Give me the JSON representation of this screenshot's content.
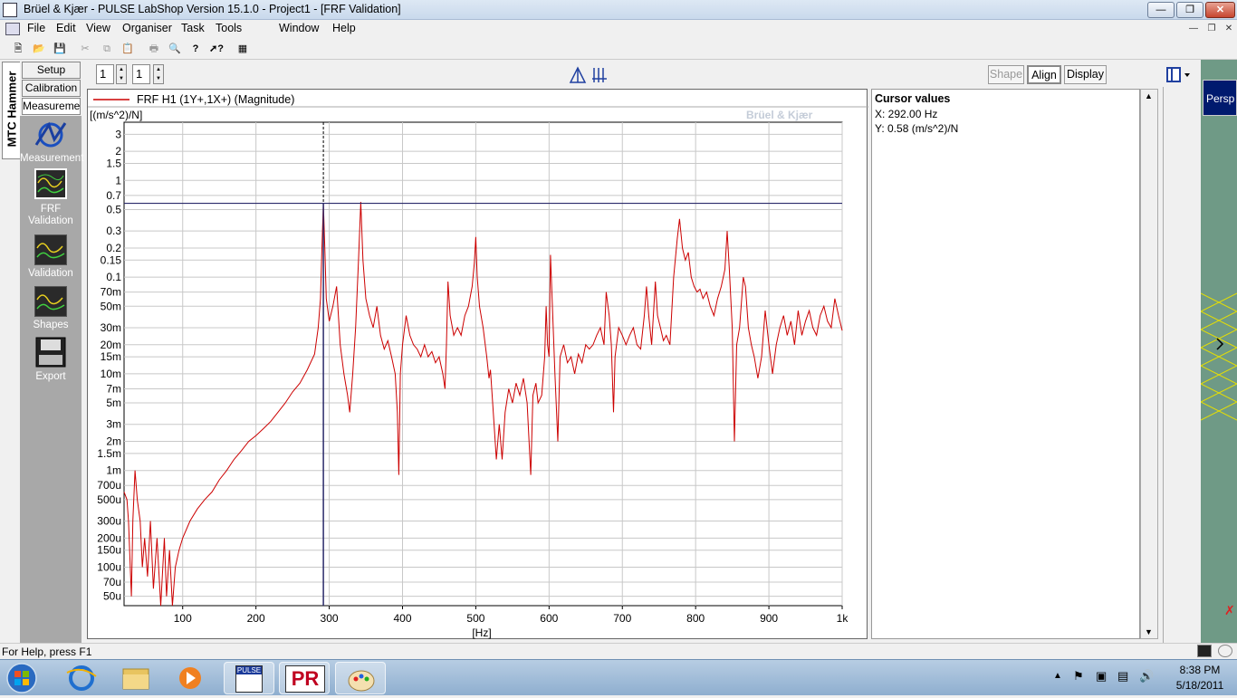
{
  "window": {
    "title": "Brüel & Kjær - PULSE LabShop Version 15.1.0 - Project1 - [FRF Validation]"
  },
  "menu": {
    "items": [
      "File",
      "Edit",
      "View",
      "Organiser",
      "Task",
      "Tools",
      "Window",
      "Help"
    ]
  },
  "spinners": {
    "first": "1",
    "second": "1"
  },
  "view_buttons": {
    "shape": "Shape",
    "align": "Align",
    "display": "Display"
  },
  "side_tabs": {
    "vertical": "MTC Hammer",
    "setup": "Setup",
    "calibration": "Calibration",
    "measurement": "Measurement"
  },
  "task_icons": [
    {
      "label": "Measurement"
    },
    {
      "label": "FRF Validation"
    },
    {
      "label": "Validation"
    },
    {
      "label": "Shapes"
    },
    {
      "label": "Export"
    }
  ],
  "graph": {
    "legend": "FRF H1 (1Y+,1X+) (Magnitude)",
    "yunit": "[(m/s^2)/N]",
    "xunit": "[Hz]",
    "watermark": "Brüel & Kjær",
    "trace_color": "#cc0000",
    "cursor_color": "#2a2a6a"
  },
  "cursor": {
    "title": "Cursor values",
    "x": "X: 292.00 Hz",
    "y": "Y: 0.58 (m/s^2)/N"
  },
  "right_tab": "Persp",
  "status": {
    "text": "For Help, press F1"
  },
  "taskbar": {
    "time": "8:38 PM",
    "date": "5/18/2011",
    "pulse_label": "PULSE",
    "pr_label": "PR"
  },
  "chart_data": {
    "type": "line",
    "xlabel": "[Hz]",
    "ylabel": "[(m/s^2)/N]",
    "xscale": "linear",
    "yscale": "log",
    "xlim": [
      20,
      1000
    ],
    "ylim": [
      4e-05,
      4
    ],
    "xticks": [
      {
        "v": 100,
        "t": "100"
      },
      {
        "v": 200,
        "t": "200"
      },
      {
        "v": 300,
        "t": "300"
      },
      {
        "v": 400,
        "t": "400"
      },
      {
        "v": 500,
        "t": "500"
      },
      {
        "v": 600,
        "t": "600"
      },
      {
        "v": 700,
        "t": "700"
      },
      {
        "v": 800,
        "t": "800"
      },
      {
        "v": 900,
        "t": "900"
      },
      {
        "v": 1000,
        "t": "1k"
      }
    ],
    "yticks": [
      {
        "v": 3,
        "t": "3"
      },
      {
        "v": 2,
        "t": "2"
      },
      {
        "v": 1.5,
        "t": "1.5"
      },
      {
        "v": 1,
        "t": "1"
      },
      {
        "v": 0.7,
        "t": "0.7"
      },
      {
        "v": 0.5,
        "t": "0.5"
      },
      {
        "v": 0.3,
        "t": "0.3"
      },
      {
        "v": 0.2,
        "t": "0.2"
      },
      {
        "v": 0.15,
        "t": "0.15"
      },
      {
        "v": 0.1,
        "t": "0.1"
      },
      {
        "v": 0.07,
        "t": "70m"
      },
      {
        "v": 0.05,
        "t": "50m"
      },
      {
        "v": 0.03,
        "t": "30m"
      },
      {
        "v": 0.02,
        "t": "20m"
      },
      {
        "v": 0.015,
        "t": "15m"
      },
      {
        "v": 0.01,
        "t": "10m"
      },
      {
        "v": 0.007,
        "t": "7m"
      },
      {
        "v": 0.005,
        "t": "5m"
      },
      {
        "v": 0.003,
        "t": "3m"
      },
      {
        "v": 0.002,
        "t": "2m"
      },
      {
        "v": 0.0015,
        "t": "1.5m"
      },
      {
        "v": 0.001,
        "t": "1m"
      },
      {
        "v": 0.0007,
        "t": "700u"
      },
      {
        "v": 0.0005,
        "t": "500u"
      },
      {
        "v": 0.0003,
        "t": "300u"
      },
      {
        "v": 0.0002,
        "t": "200u"
      },
      {
        "v": 0.00015,
        "t": "150u"
      },
      {
        "v": 0.0001,
        "t": "100u"
      },
      {
        "v": 7e-05,
        "t": "70u"
      },
      {
        "v": 5e-05,
        "t": "50u"
      }
    ],
    "cursor": {
      "x": 292,
      "y": 0.58
    },
    "series": [
      {
        "name": "FRF H1 (1Y+,1X+) (Magnitude)",
        "points": [
          [
            20,
            0.0006
          ],
          [
            24,
            0.0005
          ],
          [
            26,
            0.0003
          ],
          [
            30,
            5e-05
          ],
          [
            32,
            0.0003
          ],
          [
            35,
            0.001
          ],
          [
            38,
            0.0005
          ],
          [
            42,
            0.0003
          ],
          [
            45,
            0.0001
          ],
          [
            48,
            0.0002
          ],
          [
            52,
            8e-05
          ],
          [
            56,
            0.0003
          ],
          [
            60,
            6e-05
          ],
          [
            65,
            0.0002
          ],
          [
            70,
            4e-05
          ],
          [
            75,
            0.0002
          ],
          [
            78,
            5e-05
          ],
          [
            82,
            0.00015
          ],
          [
            86,
            4e-05
          ],
          [
            90,
            0.0001
          ],
          [
            95,
            0.00015
          ],
          [
            100,
            0.0002
          ],
          [
            110,
            0.0003
          ],
          [
            120,
            0.0004
          ],
          [
            130,
            0.0005
          ],
          [
            140,
            0.0006
          ],
          [
            150,
            0.0008
          ],
          [
            160,
            0.001
          ],
          [
            170,
            0.0013
          ],
          [
            180,
            0.0016
          ],
          [
            190,
            0.002
          ],
          [
            200,
            0.0023
          ],
          [
            210,
            0.0027
          ],
          [
            220,
            0.0032
          ],
          [
            230,
            0.004
          ],
          [
            240,
            0.005
          ],
          [
            250,
            0.0065
          ],
          [
            260,
            0.008
          ],
          [
            270,
            0.011
          ],
          [
            280,
            0.016
          ],
          [
            285,
            0.03
          ],
          [
            288,
            0.06
          ],
          [
            290,
            0.2
          ],
          [
            292,
            0.58
          ],
          [
            294,
            0.2
          ],
          [
            296,
            0.06
          ],
          [
            300,
            0.035
          ],
          [
            305,
            0.05
          ],
          [
            310,
            0.08
          ],
          [
            315,
            0.02
          ],
          [
            320,
            0.01
          ],
          [
            325,
            0.006
          ],
          [
            328,
            0.004
          ],
          [
            332,
            0.01
          ],
          [
            336,
            0.03
          ],
          [
            340,
            0.15
          ],
          [
            343,
            0.6
          ],
          [
            346,
            0.15
          ],
          [
            350,
            0.06
          ],
          [
            355,
            0.04
          ],
          [
            360,
            0.03
          ],
          [
            365,
            0.05
          ],
          [
            370,
            0.025
          ],
          [
            375,
            0.018
          ],
          [
            380,
            0.022
          ],
          [
            385,
            0.015
          ],
          [
            390,
            0.01
          ],
          [
            393,
            0.004
          ],
          [
            395,
            0.0009
          ],
          [
            397,
            0.01
          ],
          [
            400,
            0.02
          ],
          [
            405,
            0.04
          ],
          [
            410,
            0.025
          ],
          [
            415,
            0.02
          ],
          [
            420,
            0.018
          ],
          [
            425,
            0.015
          ],
          [
            430,
            0.02
          ],
          [
            435,
            0.015
          ],
          [
            440,
            0.017
          ],
          [
            445,
            0.013
          ],
          [
            450,
            0.015
          ],
          [
            455,
            0.01
          ],
          [
            458,
            0.007
          ],
          [
            460,
            0.02
          ],
          [
            462,
            0.09
          ],
          [
            465,
            0.04
          ],
          [
            470,
            0.025
          ],
          [
            475,
            0.03
          ],
          [
            480,
            0.025
          ],
          [
            485,
            0.04
          ],
          [
            490,
            0.05
          ],
          [
            495,
            0.08
          ],
          [
            498,
            0.14
          ],
          [
            500,
            0.26
          ],
          [
            502,
            0.1
          ],
          [
            505,
            0.05
          ],
          [
            510,
            0.03
          ],
          [
            515,
            0.015
          ],
          [
            518,
            0.009
          ],
          [
            520,
            0.011
          ],
          [
            525,
            0.003
          ],
          [
            528,
            0.0013
          ],
          [
            532,
            0.003
          ],
          [
            536,
            0.0013
          ],
          [
            540,
            0.004
          ],
          [
            545,
            0.007
          ],
          [
            550,
            0.005
          ],
          [
            555,
            0.008
          ],
          [
            560,
            0.006
          ],
          [
            565,
            0.009
          ],
          [
            570,
            0.005
          ],
          [
            575,
            0.0009
          ],
          [
            578,
            0.006
          ],
          [
            582,
            0.008
          ],
          [
            585,
            0.005
          ],
          [
            590,
            0.006
          ],
          [
            594,
            0.015
          ],
          [
            596,
            0.05
          ],
          [
            598,
            0.02
          ],
          [
            600,
            0.015
          ],
          [
            602,
            0.17
          ],
          [
            605,
            0.04
          ],
          [
            608,
            0.01
          ],
          [
            612,
            0.002
          ],
          [
            615,
            0.015
          ],
          [
            620,
            0.02
          ],
          [
            625,
            0.013
          ],
          [
            630,
            0.015
          ],
          [
            635,
            0.01
          ],
          [
            640,
            0.016
          ],
          [
            645,
            0.013
          ],
          [
            650,
            0.02
          ],
          [
            655,
            0.018
          ],
          [
            660,
            0.02
          ],
          [
            665,
            0.025
          ],
          [
            670,
            0.03
          ],
          [
            675,
            0.02
          ],
          [
            678,
            0.07
          ],
          [
            682,
            0.04
          ],
          [
            685,
            0.02
          ],
          [
            688,
            0.004
          ],
          [
            690,
            0.015
          ],
          [
            695,
            0.03
          ],
          [
            700,
            0.025
          ],
          [
            705,
            0.02
          ],
          [
            710,
            0.025
          ],
          [
            715,
            0.03
          ],
          [
            720,
            0.02
          ],
          [
            725,
            0.018
          ],
          [
            730,
            0.04
          ],
          [
            733,
            0.08
          ],
          [
            736,
            0.04
          ],
          [
            740,
            0.02
          ],
          [
            745,
            0.09
          ],
          [
            748,
            0.04
          ],
          [
            752,
            0.03
          ],
          [
            756,
            0.022
          ],
          [
            760,
            0.025
          ],
          [
            765,
            0.02
          ],
          [
            770,
            0.1
          ],
          [
            775,
            0.25
          ],
          [
            778,
            0.4
          ],
          [
            782,
            0.2
          ],
          [
            786,
            0.15
          ],
          [
            790,
            0.18
          ],
          [
            794,
            0.1
          ],
          [
            798,
            0.08
          ],
          [
            802,
            0.07
          ],
          [
            806,
            0.075
          ],
          [
            810,
            0.06
          ],
          [
            815,
            0.07
          ],
          [
            820,
            0.05
          ],
          [
            825,
            0.04
          ],
          [
            830,
            0.06
          ],
          [
            835,
            0.08
          ],
          [
            840,
            0.12
          ],
          [
            843,
            0.3
          ],
          [
            846,
            0.12
          ],
          [
            850,
            0.03
          ],
          [
            853,
            0.002
          ],
          [
            856,
            0.02
          ],
          [
            860,
            0.03
          ],
          [
            865,
            0.1
          ],
          [
            868,
            0.08
          ],
          [
            872,
            0.03
          ],
          [
            876,
            0.02
          ],
          [
            880,
            0.015
          ],
          [
            885,
            0.009
          ],
          [
            890,
            0.015
          ],
          [
            895,
            0.045
          ],
          [
            900,
            0.02
          ],
          [
            905,
            0.01
          ],
          [
            910,
            0.02
          ],
          [
            915,
            0.03
          ],
          [
            920,
            0.04
          ],
          [
            925,
            0.025
          ],
          [
            930,
            0.035
          ],
          [
            935,
            0.02
          ],
          [
            940,
            0.045
          ],
          [
            945,
            0.025
          ],
          [
            950,
            0.035
          ],
          [
            955,
            0.045
          ],
          [
            960,
            0.03
          ],
          [
            965,
            0.025
          ],
          [
            970,
            0.04
          ],
          [
            975,
            0.05
          ],
          [
            980,
            0.035
          ],
          [
            985,
            0.03
          ],
          [
            990,
            0.06
          ],
          [
            995,
            0.04
          ],
          [
            1000,
            0.028
          ]
        ]
      }
    ]
  }
}
